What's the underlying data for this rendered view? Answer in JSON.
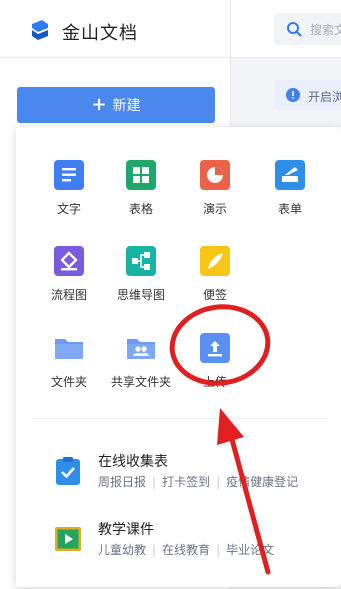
{
  "app": {
    "brand": "金山文档",
    "search_placeholder": "搜索文",
    "new_button": "新建",
    "notice": "开启浏"
  },
  "menu": {
    "grid": [
      {
        "label": "文字",
        "icon": "doc-icon",
        "color": "#3f7ef3"
      },
      {
        "label": "表格",
        "icon": "sheet-icon",
        "color": "#1ea96b"
      },
      {
        "label": "演示",
        "icon": "slides-icon",
        "color": "#ea6247"
      },
      {
        "label": "表单",
        "icon": "form-icon",
        "color": "#2f8fe8"
      },
      {
        "label": "流程图",
        "icon": "flowchart-icon",
        "color": "#7a5bde"
      },
      {
        "label": "思维导图",
        "icon": "mindmap-icon",
        "color": "#19b3a5"
      },
      {
        "label": "便签",
        "icon": "note-icon",
        "color": "#f6c515"
      },
      {
        "label": "文件夹",
        "icon": "folder-icon",
        "color": "#6c9bf0"
      },
      {
        "label": "共享文件夹",
        "icon": "shared-folder-icon",
        "color": "#6c9bf0"
      },
      {
        "label": "上传",
        "icon": "upload-icon",
        "color": "#5b8ff2"
      }
    ],
    "list": [
      {
        "title": "在线收集表",
        "tags": [
          "周报日报",
          "打卡签到",
          "疫情健康登记"
        ],
        "icon": "collect-form-icon"
      },
      {
        "title": "教学课件",
        "tags": [
          "儿童幼教",
          "在线教育",
          "毕业论文"
        ],
        "icon": "courseware-icon"
      }
    ]
  },
  "colors": {
    "primary": "#4a88ee",
    "annotation": "#e02020"
  }
}
